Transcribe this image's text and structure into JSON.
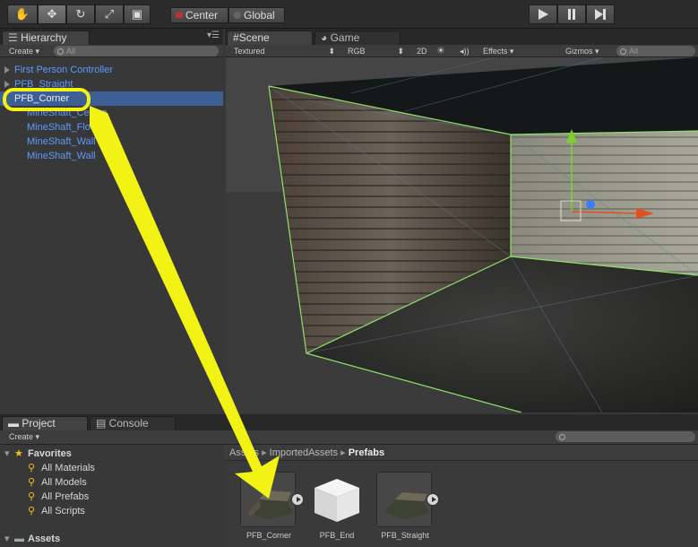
{
  "toolbar": {
    "tools": [
      "hand-icon",
      "move-icon",
      "rotate-icon",
      "scale-icon",
      "rect-icon"
    ],
    "pivot_label": "Center",
    "space_label": "Global",
    "playback": [
      "play-icon",
      "pause-icon",
      "step-icon"
    ]
  },
  "hierarchy": {
    "tab_label": "Hierarchy",
    "create_label": "Create",
    "search_placeholder": "All",
    "items": [
      {
        "label": "First Person Controller",
        "expandable": true,
        "selected": false,
        "indent": 0
      },
      {
        "label": "PFB_Straight",
        "expandable": true,
        "selected": false,
        "indent": 0
      },
      {
        "label": "PFB_Corner",
        "expandable": false,
        "selected": true,
        "indent": 0
      },
      {
        "label": "MineShaft_Ceiling",
        "expandable": false,
        "selected": false,
        "indent": 1
      },
      {
        "label": "MineShaft_Floor",
        "expandable": false,
        "selected": false,
        "indent": 1
      },
      {
        "label": "MineShaft_Wall",
        "expandable": false,
        "selected": false,
        "indent": 1
      },
      {
        "label": "MineShaft_Wall",
        "expandable": false,
        "selected": false,
        "indent": 1
      }
    ]
  },
  "scene": {
    "tab_scene": "Scene",
    "tab_game": "Game",
    "shading": "Textured",
    "render_mode": "RGB",
    "mode_2d": "2D",
    "effects_label": "Effects",
    "gizmos_label": "Gizmos",
    "search_placeholder": "All",
    "colors": {
      "selection": "#8fe36a",
      "y_axis": "#7ad12c",
      "x_axis": "#e0501e",
      "z_axis": "#3c7cff"
    }
  },
  "project": {
    "tab_project": "Project",
    "tab_console": "Console",
    "create_label": "Create",
    "favorites_label": "Favorites",
    "favorites": [
      "All Materials",
      "All Models",
      "All Prefabs",
      "All Scripts"
    ],
    "assets_label": "Assets",
    "breadcrumb": [
      "Assets",
      "ImportedAssets",
      "Prefabs"
    ],
    "assets": [
      {
        "name": "PFB_Corner"
      },
      {
        "name": "PFB_End"
      },
      {
        "name": "PFB_Straight"
      }
    ]
  },
  "annotation": {
    "highlight_color": "#f2f215"
  }
}
